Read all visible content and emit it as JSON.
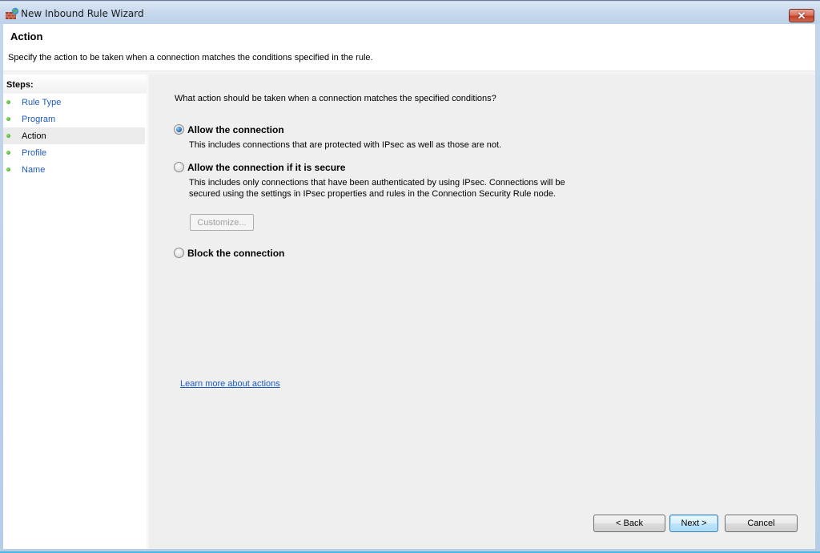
{
  "window": {
    "title": "New Inbound Rule Wizard",
    "close_label": "✕"
  },
  "header": {
    "title": "Action",
    "description": "Specify the action to be taken when a connection matches the conditions specified in the rule."
  },
  "steps": {
    "heading": "Steps:",
    "items": [
      {
        "label": "Rule Type",
        "current": false
      },
      {
        "label": "Program",
        "current": false
      },
      {
        "label": "Action",
        "current": true
      },
      {
        "label": "Profile",
        "current": false
      },
      {
        "label": "Name",
        "current": false
      }
    ]
  },
  "main": {
    "question": "What action should be taken when a connection matches the specified conditions?",
    "options": [
      {
        "label": "Allow the connection",
        "description": "This includes connections that are protected with IPsec as well as those are not.",
        "selected": true
      },
      {
        "label": "Allow the connection if it is secure",
        "description": "This includes only connections that have been authenticated by using IPsec.  Connections will be secured using the settings in IPsec properties and rules in the Connection Security Rule node.",
        "selected": false
      },
      {
        "label": "Block the connection",
        "description": "",
        "selected": false
      }
    ],
    "customize_label": "Customize...",
    "learn_more_link": "Learn more about actions"
  },
  "buttons": {
    "back": "< Back",
    "next": "Next >",
    "cancel": "Cancel"
  },
  "colors": {
    "link": "#1e5bbf",
    "close_button": "#c2412a",
    "default_button_border": "#3c7fb1"
  }
}
